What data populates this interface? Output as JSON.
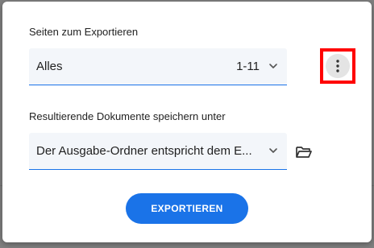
{
  "dialog": {
    "pages_section": {
      "label": "Seiten zum Exportieren",
      "selected_value": "Alles",
      "range": "1-11",
      "chevron_icon": "chevron-down-icon",
      "menu_icon": "more-vert-icon"
    },
    "save_section": {
      "label": "Resultierende Dokumente speichern unter",
      "selected_value": "Der Ausgabe-Ordner entspricht dem E...",
      "chevron_icon": "chevron-down-icon",
      "folder_icon": "folder-open-icon"
    },
    "export_button": {
      "label": "EXPORTIEREN",
      "color": "#1a73e8"
    },
    "highlight_color": "#ff0000"
  }
}
